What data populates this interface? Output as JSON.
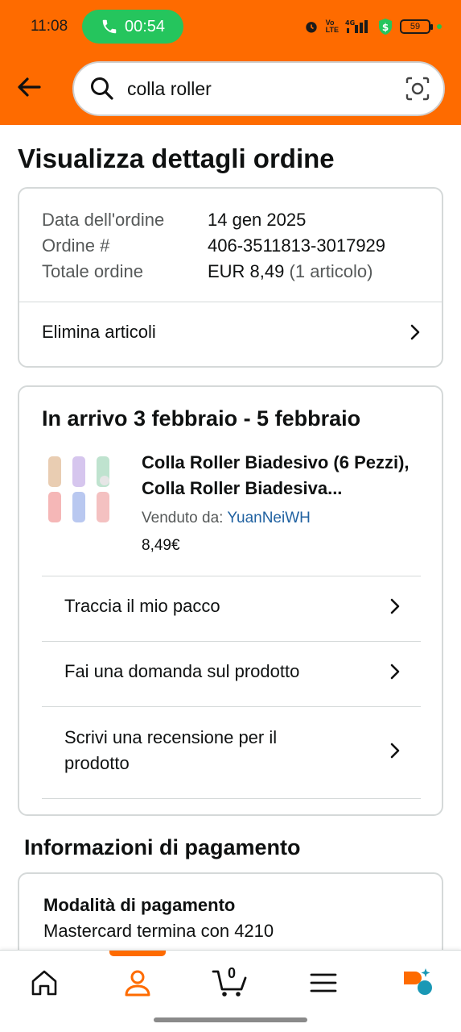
{
  "status_bar": {
    "time": "11:08",
    "call_timer": "00:54",
    "battery": "59"
  },
  "search": {
    "query": "colla roller"
  },
  "page": {
    "title": "Visualizza dettagli ordine"
  },
  "order_summary": {
    "date_label": "Data dell'ordine",
    "date_value": "14 gen 2025",
    "number_label": "Ordine #",
    "number_value": "406-3511813-3017929",
    "total_label": "Totale ordine",
    "total_value": "EUR 8,49",
    "total_items": "(1 articolo)",
    "delete_label": "Elimina articoli"
  },
  "shipment": {
    "arrival": "In arrivo 3 febbraio - 5 febbraio",
    "product_title": "Colla Roller Biadesivo (6 Pezzi), Colla Roller Biadesiva...",
    "sold_by_label": "Venduto da:",
    "seller": "YuanNeiWH",
    "price": "8,49€",
    "actions": [
      {
        "label": "Traccia il mio pacco"
      },
      {
        "label": "Fai una domanda sul prodotto"
      },
      {
        "label": "Scrivi una recensione per il prodotto"
      }
    ]
  },
  "payment": {
    "section_title": "Informazioni di pagamento",
    "method_label": "Modalità di pagamento",
    "method_value": "Mastercard  termina con 4210"
  },
  "bottom_nav": {
    "cart_count": "0"
  },
  "colors": {
    "brand": "#fe6b00",
    "link": "#2162a1",
    "call_green": "#25c55d"
  }
}
